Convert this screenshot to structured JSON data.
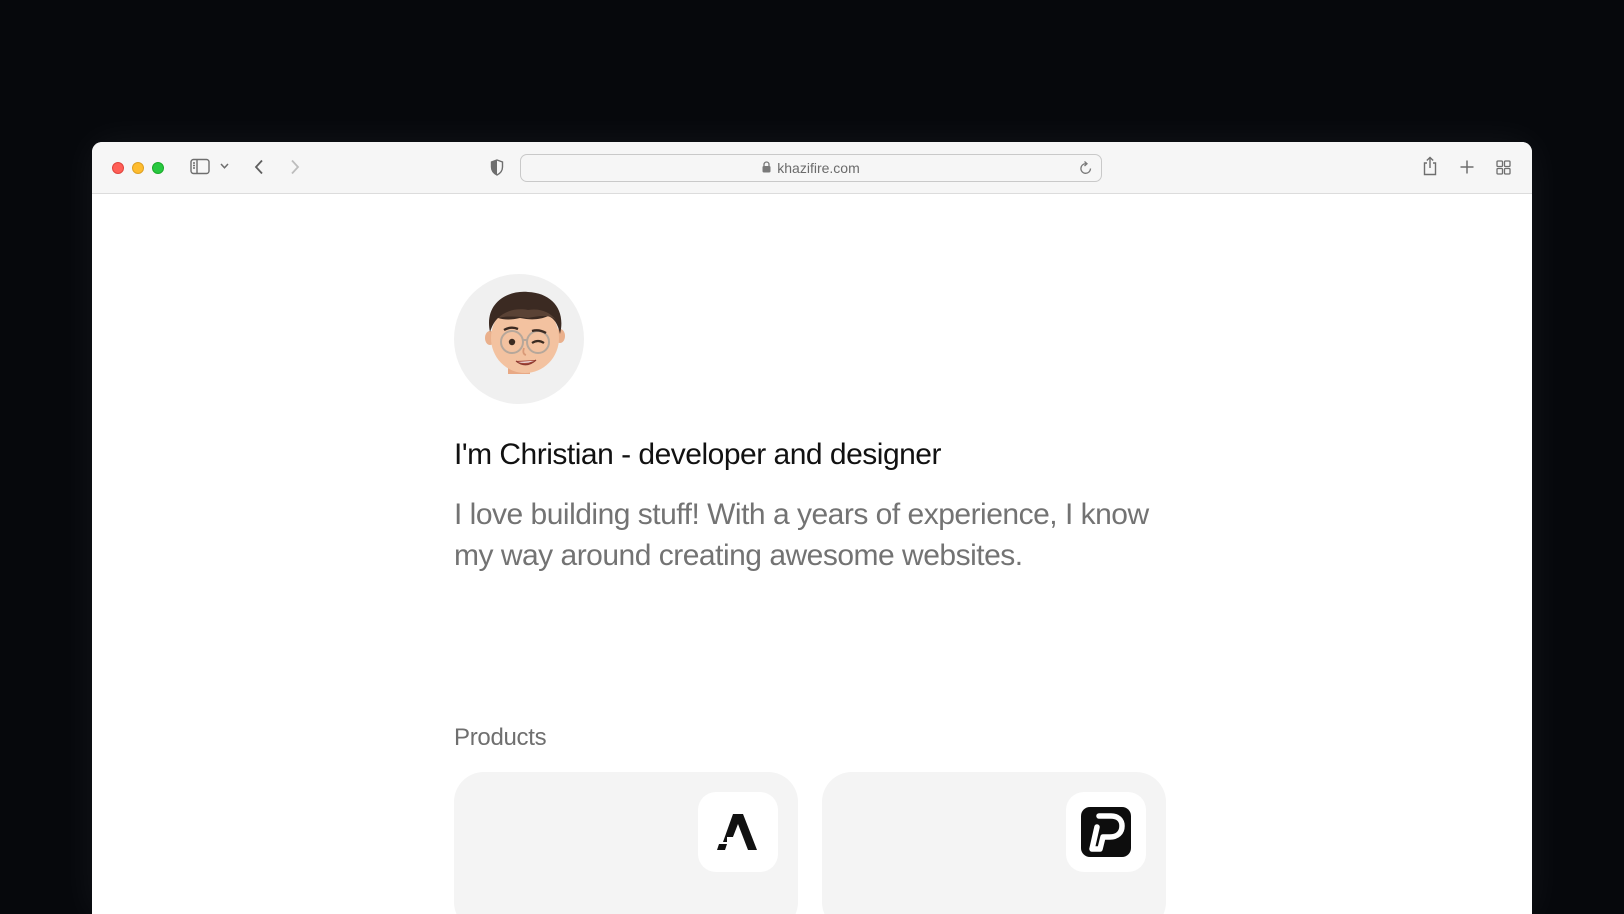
{
  "browser": {
    "url": "khazifire.com"
  },
  "page": {
    "headline": "I'm Christian - developer and designer",
    "intro": "I love building stuff! With a years of experience, I know my way around creating awesome websites.",
    "products_label": "Products",
    "products": [
      {
        "icon": "a-logo-icon"
      },
      {
        "icon": "p-logo-icon"
      }
    ]
  },
  "colors": {
    "background": "#06080c",
    "toolbar": "#f6f6f6",
    "headline": "#111111",
    "muted_text": "#737373",
    "card": "#f4f4f4"
  }
}
